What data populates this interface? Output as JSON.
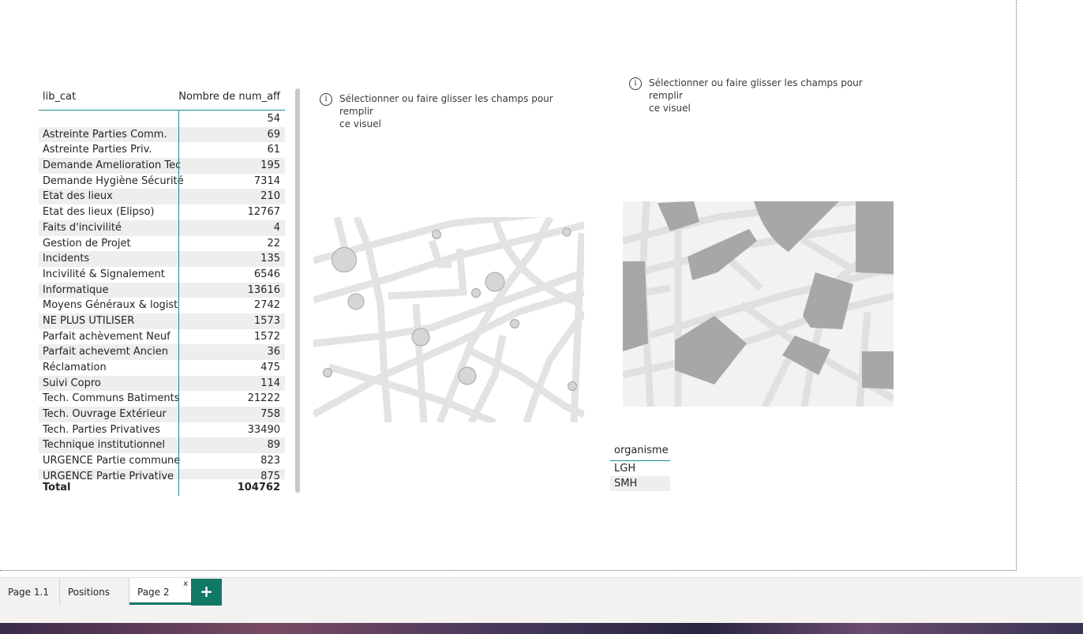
{
  "table": {
    "col1_header": "lib_cat",
    "col2_header": "Nombre de num_aff",
    "rows": [
      {
        "cat": "",
        "val": "54"
      },
      {
        "cat": "Astreinte Parties Comm.",
        "val": "69"
      },
      {
        "cat": "Astreinte Parties Priv.",
        "val": "61"
      },
      {
        "cat": "Demande Amelioration Tec",
        "val": "195"
      },
      {
        "cat": "Demande Hygiène Sécurité",
        "val": "7314"
      },
      {
        "cat": "Etat des lieux",
        "val": "210"
      },
      {
        "cat": "Etat des lieux (Elipso)",
        "val": "12767"
      },
      {
        "cat": "Faits d'incivilité",
        "val": "4"
      },
      {
        "cat": "Gestion de Projet",
        "val": "22"
      },
      {
        "cat": "Incidents",
        "val": "135"
      },
      {
        "cat": "Incivilité & Signalement",
        "val": "6546"
      },
      {
        "cat": "Informatique",
        "val": "13616"
      },
      {
        "cat": "Moyens Généraux & logist",
        "val": "2742"
      },
      {
        "cat": "NE PLUS UTILISER",
        "val": "1573"
      },
      {
        "cat": "Parfait achèvement Neuf",
        "val": "1572"
      },
      {
        "cat": "Parfait achevemt Ancien",
        "val": "36"
      },
      {
        "cat": "Réclamation",
        "val": "475"
      },
      {
        "cat": "Suivi Copro",
        "val": "114"
      },
      {
        "cat": "Tech. Communs Batiments",
        "val": "21222"
      },
      {
        "cat": "Tech. Ouvrage Extérieur",
        "val": "758"
      },
      {
        "cat": "Tech. Parties Privatives",
        "val": "33490"
      },
      {
        "cat": "Technique institutionnel",
        "val": "89"
      },
      {
        "cat": "URGENCE Partie commune",
        "val": "823"
      },
      {
        "cat": "URGENCE Partie Privative",
        "val": "875"
      }
    ],
    "total_label": "Total",
    "total_value": "104762"
  },
  "placeholder": {
    "info_glyph": "i",
    "line1": "Sélectionner ou faire glisser les champs pour remplir",
    "line2": "ce visuel"
  },
  "slicer": {
    "header": "organisme",
    "items": [
      "LGH",
      "SMH"
    ]
  },
  "tabs": {
    "items": [
      "Page 1.1",
      "Positions",
      "Page 2"
    ],
    "active": "Page 2",
    "close_glyph": "x",
    "add_glyph": "+"
  },
  "colors": {
    "accent": "#117865",
    "table_line": "#1a8f89",
    "map_road": "#e3e3e3",
    "map_block": "#a7a7a9"
  }
}
